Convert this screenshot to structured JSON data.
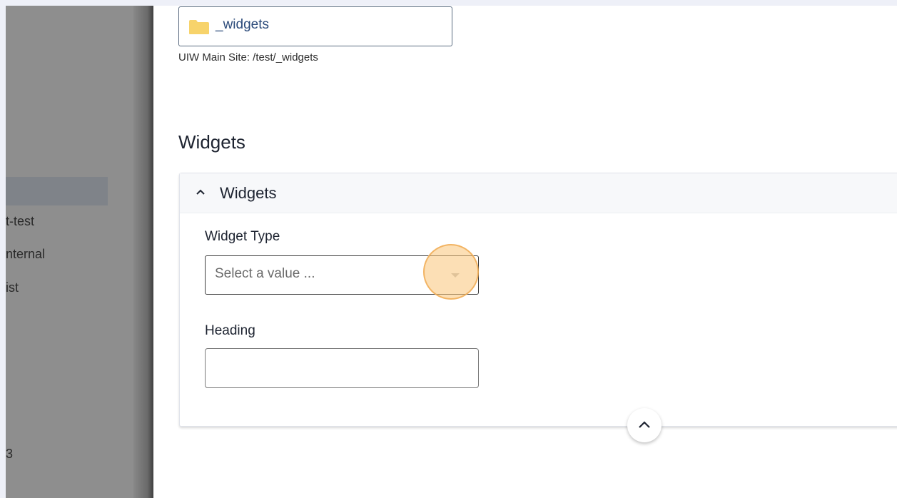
{
  "sidebar": {
    "items": [
      {
        "label": "t-test"
      },
      {
        "label": "nternal"
      },
      {
        "label": "ist"
      },
      {
        "label": "3"
      }
    ]
  },
  "folder": {
    "name": "_widgets",
    "path": "UIW Main Site: /test/_widgets",
    "icon": "folder-icon",
    "icon_color": "#f7d36b"
  },
  "section": {
    "title": "Widgets"
  },
  "accordion": {
    "title": "Widgets",
    "icon": "chevron-up-icon",
    "fields": {
      "widget_type": {
        "label": "Widget Type",
        "placeholder": "Select a value ..."
      },
      "heading": {
        "label": "Heading",
        "value": ""
      }
    },
    "collapse_icon": "chevron-up-icon"
  },
  "colors": {
    "highlight": "#fac478",
    "folder_text": "#2b4a7a"
  }
}
